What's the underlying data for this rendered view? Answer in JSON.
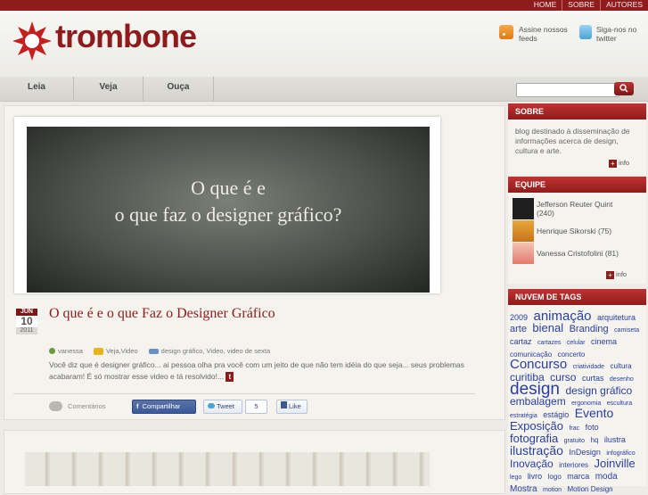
{
  "topnav": [
    "HOME",
    "SOBRE",
    "AUTORES"
  ],
  "logo": {
    "text": "trombone",
    "color": "#8e1c1c"
  },
  "header": {
    "feeds_label": "Assine nossos feeds",
    "twitter_label": "Siga-nos no twitter"
  },
  "nav": [
    {
      "label": "Leia"
    },
    {
      "label": "Veja"
    },
    {
      "label": "Ouça"
    }
  ],
  "search": {
    "placeholder": "",
    "value": ""
  },
  "post": {
    "video_line1": "O que é e",
    "video_line2": "o que faz o designer gráfico?",
    "date": {
      "month": "JUN",
      "day": "10",
      "year": "2011"
    },
    "title": "O que é e o que Faz o Designer Gráfico",
    "author": "vanessa",
    "categories": "Veja,Video",
    "tags": "design gráfico, Video, video de sexta",
    "excerpt": "Você diz que é designer gráfico... ai pessoa olha pra você com um jeito de que não tem idéia do que seja... seus problemas acabaram! É só mostrar esse video e tá resolvido!...",
    "more": "t",
    "comments": "Comentários",
    "fb_share": "Compartilhar",
    "tweet": "Tweet",
    "tweet_count": "5",
    "like": "Like"
  },
  "sidebar": {
    "sobre_title": "SOBRE",
    "sobre_text": "blog destinado à disseminação de informações acerca de design, cultura e arte.",
    "info_label": "info",
    "equipe_title": "EQUIPE",
    "members": [
      {
        "name": "Jefferson Reuter Quint",
        "count": "(240)"
      },
      {
        "name": "Henrique Sikorski",
        "count": "(75)"
      },
      {
        "name": "Vanessa Cristofolini",
        "count": "(81)"
      }
    ],
    "tags_title": "NUVEM DE TAGS",
    "tags": [
      {
        "t": "2009",
        "s": 9
      },
      {
        "t": "animação",
        "s": 15
      },
      {
        "t": "arquitetura",
        "s": 9
      },
      {
        "t": "arte",
        "s": 11
      },
      {
        "t": "bienal",
        "s": 13
      },
      {
        "t": "Branding",
        "s": 11
      },
      {
        "t": "camiseta",
        "s": 7
      },
      {
        "t": "cartaz",
        "s": 9
      },
      {
        "t": "cartazes",
        "s": 7
      },
      {
        "t": "celular",
        "s": 7
      },
      {
        "t": "cinema",
        "s": 9
      },
      {
        "t": "comunicação",
        "s": 8
      },
      {
        "t": "concerto",
        "s": 8
      },
      {
        "t": "Concurso",
        "s": 15
      },
      {
        "t": "criatividade",
        "s": 7
      },
      {
        "t": "cultura",
        "s": 8
      },
      {
        "t": "curitiba",
        "s": 12
      },
      {
        "t": "curso",
        "s": 12
      },
      {
        "t": "curtas",
        "s": 9
      },
      {
        "t": "desenho",
        "s": 7
      },
      {
        "t": "design",
        "s": 19
      },
      {
        "t": "design gráfico",
        "s": 12
      },
      {
        "t": "embalagem",
        "s": 12
      },
      {
        "t": "ergonomia",
        "s": 7
      },
      {
        "t": "escultura",
        "s": 7
      },
      {
        "t": "estratégia",
        "s": 7
      },
      {
        "t": "estágio",
        "s": 9
      },
      {
        "t": "Evento",
        "s": 14
      },
      {
        "t": "Exposição",
        "s": 13
      },
      {
        "t": "frac",
        "s": 7
      },
      {
        "t": "foto",
        "s": 9
      },
      {
        "t": "fotografia",
        "s": 13
      },
      {
        "t": "gratuito",
        "s": 7
      },
      {
        "t": "hq",
        "s": 8
      },
      {
        "t": "ilustra",
        "s": 9
      },
      {
        "t": "ilustração",
        "s": 14
      },
      {
        "t": "InDesign",
        "s": 9
      },
      {
        "t": "infográfico",
        "s": 7
      },
      {
        "t": "Inovação",
        "s": 12
      },
      {
        "t": "interiores",
        "s": 8
      },
      {
        "t": "Joinville",
        "s": 13
      },
      {
        "t": "lego",
        "s": 7
      },
      {
        "t": "livro",
        "s": 9
      },
      {
        "t": "logo",
        "s": 8
      },
      {
        "t": "marca",
        "s": 9
      },
      {
        "t": "moda",
        "s": 10
      },
      {
        "t": "Mostra",
        "s": 10
      },
      {
        "t": "motion",
        "s": 7
      },
      {
        "t": "Motion Design",
        "s": 8
      }
    ]
  }
}
